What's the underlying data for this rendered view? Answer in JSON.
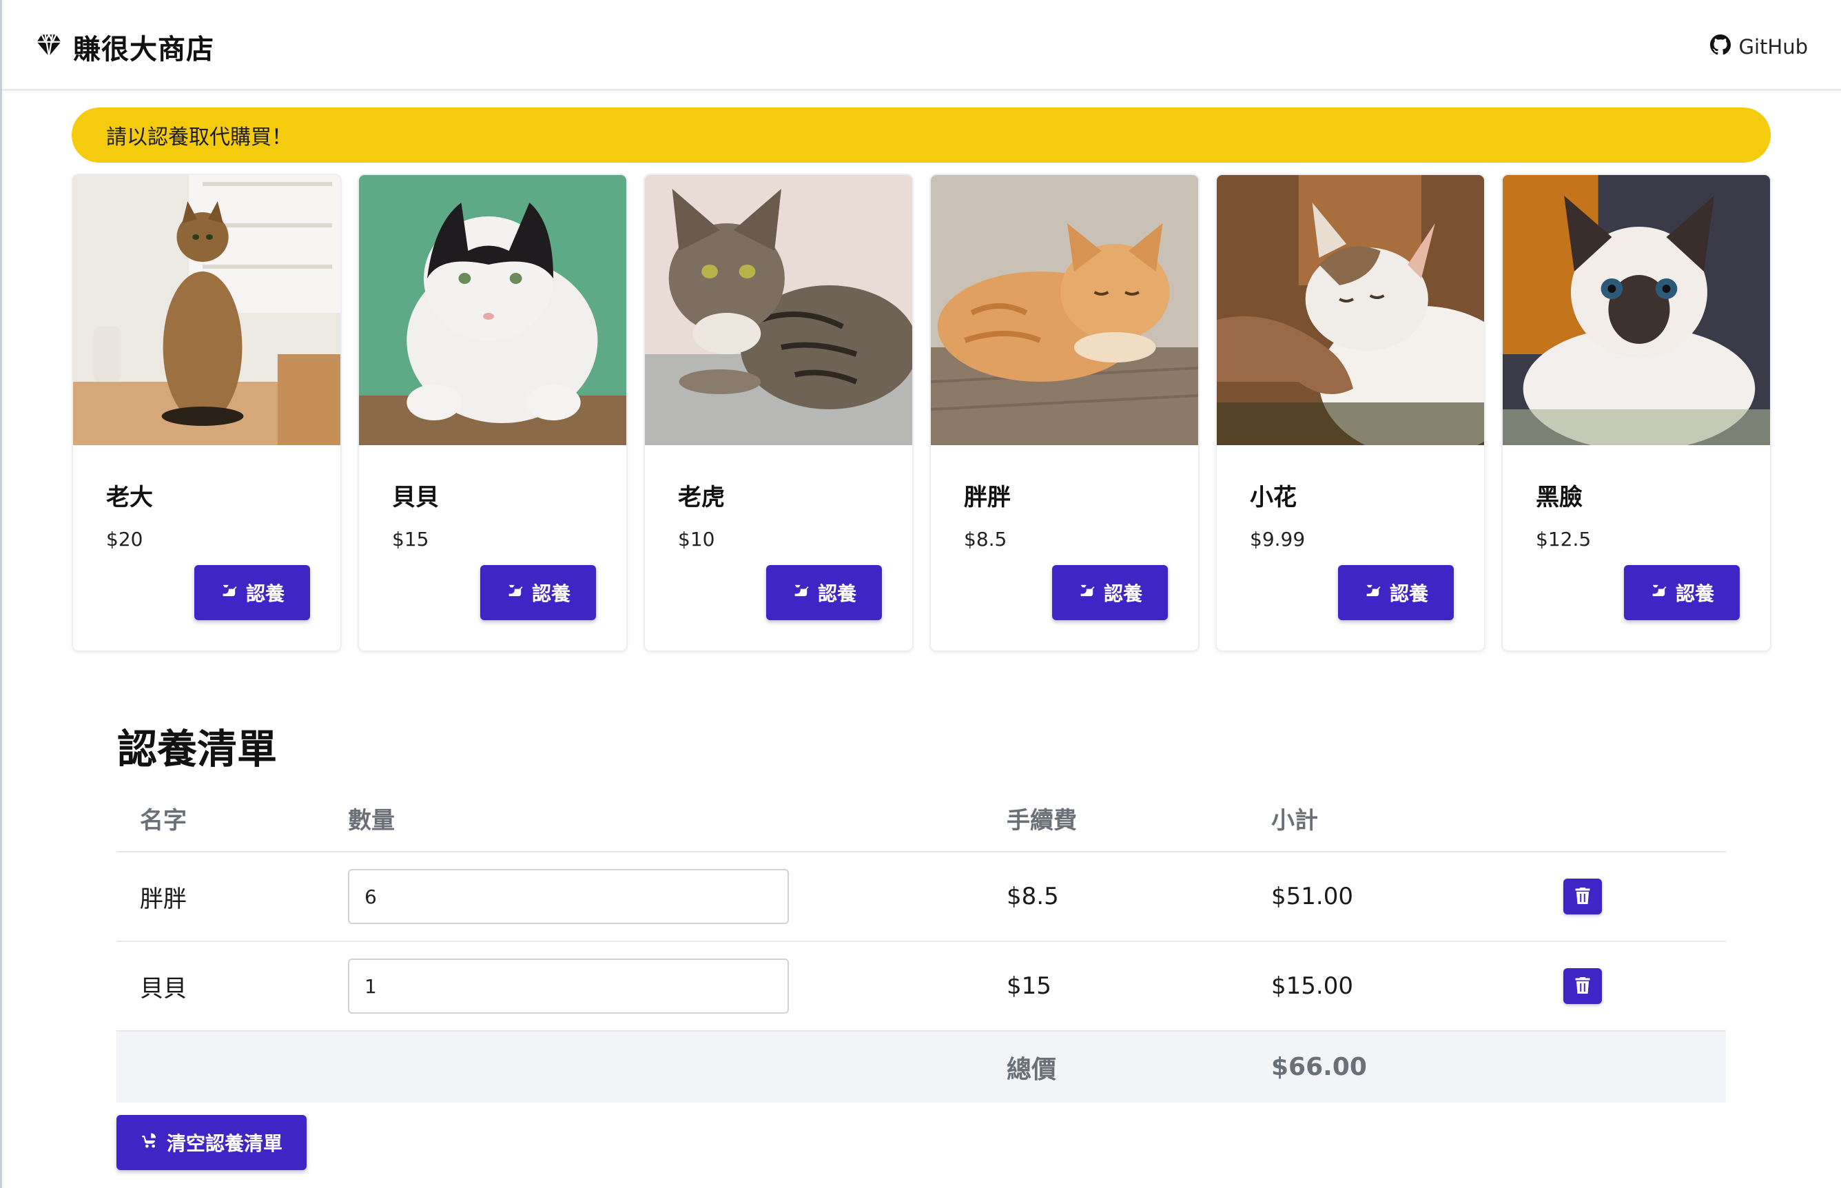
{
  "navbar": {
    "brand": "賺很大商店",
    "brand_icon": "diamond-icon",
    "github_label": "GitHub",
    "github_icon": "github-icon"
  },
  "alert": {
    "text": "請以認養取代購買！",
    "color": "#f5cb0d"
  },
  "accent_color": "#3f25c6",
  "cats": [
    {
      "name": "老大",
      "price": "$20",
      "button": "認養"
    },
    {
      "name": "貝貝",
      "price": "$15",
      "button": "認養"
    },
    {
      "name": "老虎",
      "price": "$10",
      "button": "認養"
    },
    {
      "name": "胖胖",
      "price": "$8.5",
      "button": "認養"
    },
    {
      "name": "小花",
      "price": "$9.99",
      "button": "認養"
    },
    {
      "name": "黑臉",
      "price": "$12.5",
      "button": "認養"
    }
  ],
  "adoption_list": {
    "title": "認養清單",
    "headers": {
      "name": "名字",
      "qty": "數量",
      "fee": "手續費",
      "subtotal": "小計"
    },
    "rows": [
      {
        "name": "胖胖",
        "qty": "6",
        "fee": "$8.5",
        "subtotal": "$51.00"
      },
      {
        "name": "貝貝",
        "qty": "1",
        "fee": "$15",
        "subtotal": "$15.00"
      }
    ],
    "total_label": "總價",
    "total_value": "$66.00",
    "clear_button": "清空認養清單"
  }
}
